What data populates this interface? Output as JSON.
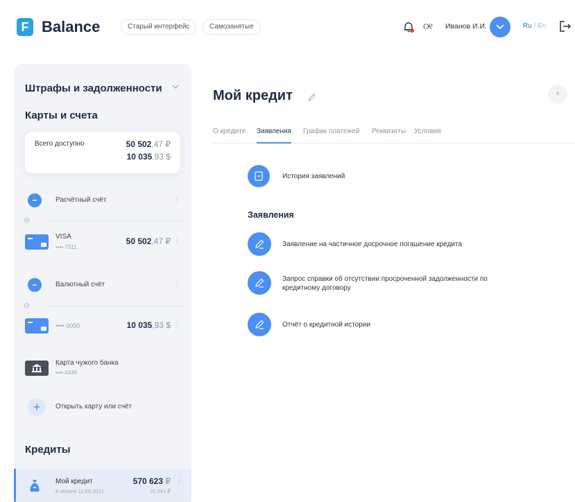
{
  "header": {
    "logo_letter": "F",
    "logo_text": "Balance",
    "old_ui_label": "Старый интерфейс",
    "self_employed_label": "Самозанятые",
    "glasses_glyph": "୦୧",
    "user_name": "Иванов И.И.",
    "lang_ru": "Ru",
    "lang_sep": " / ",
    "lang_en": "En"
  },
  "sidebar": {
    "fines_title": "Штрафы и задолженности",
    "cards_title": "Карты и счета",
    "total": {
      "label": "Всего доступно",
      "rub_int": "50 502",
      "rub_frac": ",47 ₽",
      "usd_int": "10 035",
      "usd_frac": ",93 $"
    },
    "accounts": [
      {
        "label": "Расчётный счёт",
        "card_name": "VISA",
        "card_num": "•••• 7311",
        "amt_int": "50 502",
        "amt_frac": ",47 ₽"
      },
      {
        "label": "Валютный счёт",
        "card_num": "•••• 0000",
        "amt_int": "10 035",
        "amt_frac": ",93 $"
      }
    ],
    "other_bank": {
      "name": "Карта чужого банка",
      "num": "•••• 0436"
    },
    "open_label": "Открыть карту или счёт",
    "credits_title": "Кредиты",
    "credit": {
      "name": "Мой кредит",
      "due": "К оплате 11.03.2021",
      "amt_int": "570 623",
      "amt_frac": " ₽",
      "sub": "31 541 ₽"
    },
    "kebab": "⋮",
    "link_glyph": "⊖"
  },
  "main": {
    "title": "Мой кредит",
    "close_glyph": "×",
    "tabs": [
      "О кредите",
      "Заявления",
      "График платежей",
      "Реквизиты",
      "Условия"
    ],
    "active_tab": "Заявления",
    "history_label": "История заявлений",
    "section_title": "Заявления",
    "applications": [
      "Заявление на частичное досрочное погашение кредита",
      "Запрос справки об отсутствии просроченной задолженности по кредитному договору",
      "Отчёт о кредитной истории"
    ]
  },
  "colors": {
    "accent": "#4b8ff0",
    "logo": "#2e9fe0",
    "sidebar_bg": "#f2f4f8",
    "text_dark": "#1f2a44"
  },
  "icons": {
    "bell": "bell-icon",
    "logout": "logout-icon",
    "chevron": "chevron-down-icon",
    "pencil": "pencil-icon",
    "document": "document-icon",
    "bank": "bank-icon",
    "money_bag": "money-bag-icon"
  }
}
